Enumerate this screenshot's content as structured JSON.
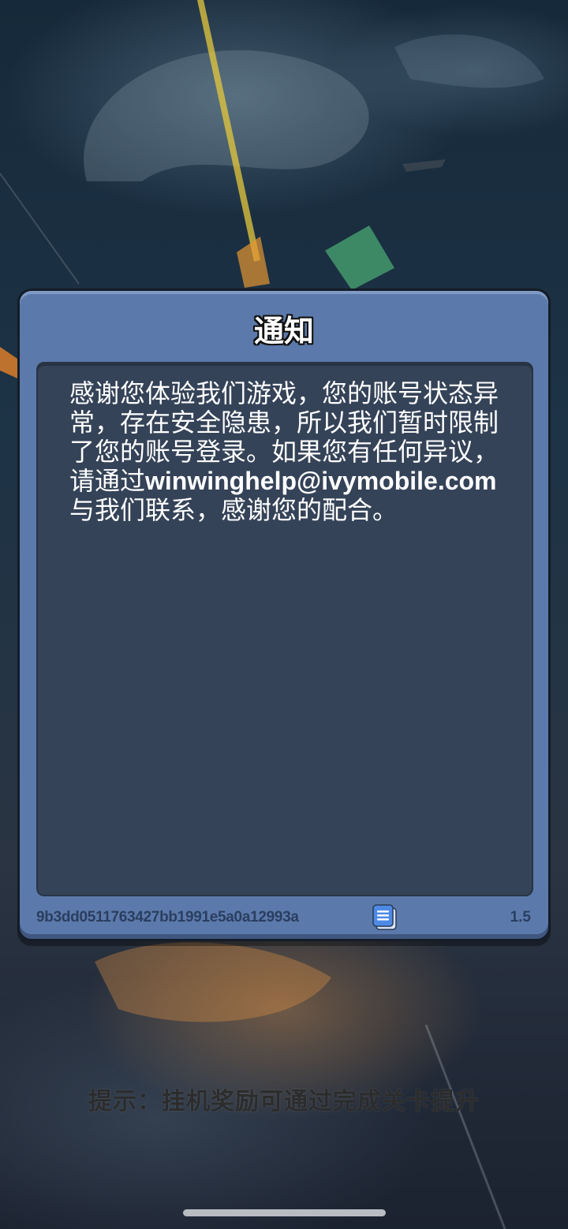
{
  "modal": {
    "title": "通知",
    "message_before_email": "感谢您体验我们游戏，您的账号状态异常，存在安全隐患，所以我们暂时限制了您的账号登录。如果您有任何异议，请通过",
    "email": "winwinghelp@ivymobile.com",
    "message_after_email": "与我们联系，感谢您的配合。",
    "account_id": "9b3dd0511763427bb1991e5a0a12993a",
    "version": "1.5",
    "copy_icon": "document-copy-icon"
  },
  "hint": {
    "text": "提示：挂机奖励可通过完成关卡提升"
  },
  "colors": {
    "panel": "#5b7aab",
    "content_bg": "#354358",
    "footer_text": "#2b3e5f"
  }
}
